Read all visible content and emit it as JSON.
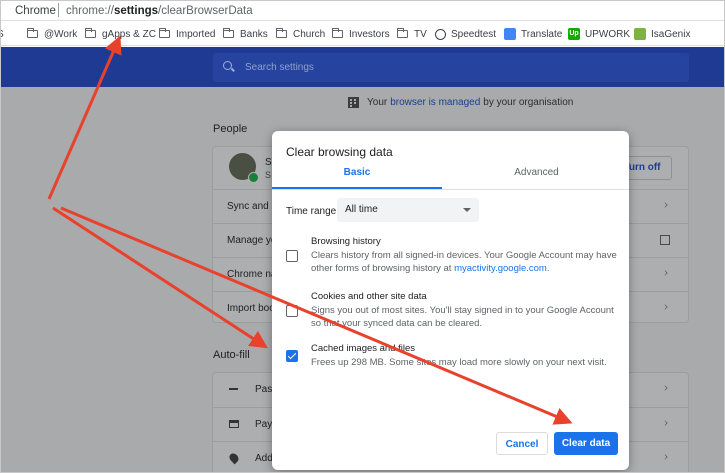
{
  "address_bar": {
    "browser_label": "Chrome",
    "url_prefix": "chrome://",
    "url_bold": "settings",
    "url_suffix": "/clearBrowserData"
  },
  "bookmarks": [
    {
      "label": "S",
      "icon": "folder-icon"
    },
    {
      "label": "@Work",
      "icon": "folder-icon"
    },
    {
      "label": "gApps & ZC",
      "icon": "folder-icon"
    },
    {
      "label": "Imported",
      "icon": "folder-icon"
    },
    {
      "label": "Banks",
      "icon": "folder-icon"
    },
    {
      "label": "Church",
      "icon": "folder-icon"
    },
    {
      "label": "Investors",
      "icon": "folder-icon"
    },
    {
      "label": "TV",
      "icon": "folder-icon"
    },
    {
      "label": "Speedtest",
      "icon": "speedometer-icon"
    },
    {
      "label": "Translate",
      "icon": "translate-icon"
    },
    {
      "label": "UPWORK",
      "icon": "upwork-icon",
      "icon_text": "Up"
    },
    {
      "label": "IsaGenix",
      "icon": "isagenix-icon"
    }
  ],
  "search": {
    "placeholder": "Search settings"
  },
  "managed_notice": {
    "pre": "Your",
    "link": "browser is managed",
    "post": "by your organisation"
  },
  "people": {
    "title": "People",
    "profile_initial_1": "S",
    "profile_initial_2": "S",
    "turn_off_label": "Turn off",
    "rows": [
      "Sync and G",
      "Manage yo",
      "Chrome na",
      "Import boo"
    ]
  },
  "autofill": {
    "title": "Auto-fill",
    "rows": [
      "Pass",
      "Payi",
      "Addi"
    ]
  },
  "dialog": {
    "title": "Clear browsing data",
    "tabs": {
      "basic": "Basic",
      "advanced": "Advanced"
    },
    "time_range_label": "Time range",
    "time_range_value": "All time",
    "options": [
      {
        "title": "Browsing history",
        "desc": "Clears history from all signed-in devices. Your Google Account may have other forms of browsing history at",
        "link": "myactivity.google.com",
        "desc_after": ".",
        "checked": false
      },
      {
        "title": "Cookies and other site data",
        "desc": "Signs you out of most sites. You'll stay signed in to your Google Account so that your synced data can be cleared.",
        "link": "",
        "desc_after": "",
        "checked": false
      },
      {
        "title": "Cached images and files",
        "desc": "Frees up 298 MB. Some sites may load more slowly on your next visit.",
        "link": "",
        "desc_after": "",
        "checked": true
      }
    ],
    "cancel_label": "Cancel",
    "clear_label": "Clear data"
  },
  "colors": {
    "header_blue": "#1f3a93",
    "accent_blue": "#1a73e8",
    "annotation_red": "#e8412c"
  }
}
